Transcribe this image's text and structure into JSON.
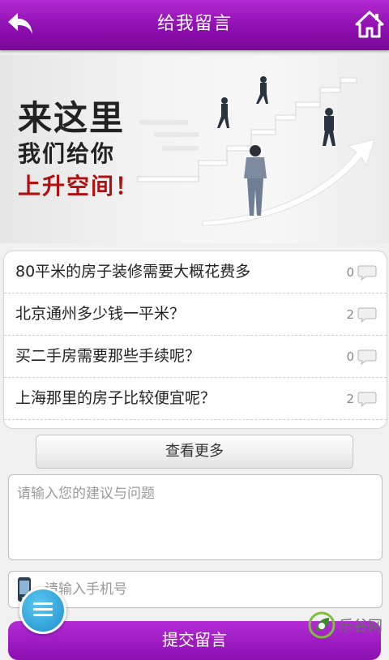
{
  "header": {
    "title": "给我留言",
    "back_icon": "back-arrow-icon",
    "home_icon": "home-icon"
  },
  "banner": {
    "line1": "来这里",
    "line2": "我们给你",
    "line3": "上升空间！"
  },
  "questions": [
    {
      "text": "80平米的房子装修需要大概花费多",
      "count": "0"
    },
    {
      "text": "北京通州多少钱一平米？",
      "count": "2"
    },
    {
      "text": "买二手房需要那些手续呢？",
      "count": "0"
    },
    {
      "text": "上海那里的房子比较便宜呢？",
      "count": "2"
    }
  ],
  "more_label": "查看更多",
  "suggestion_input": {
    "placeholder": "请输入您的建议与问题"
  },
  "phone_input": {
    "placeholder": "请输入手机号"
  },
  "submit_label": "提交留言",
  "watermark": {
    "text": "乐谷网"
  },
  "colors": {
    "brand": "#9a1cc0",
    "fab": "#2a9ad6"
  }
}
